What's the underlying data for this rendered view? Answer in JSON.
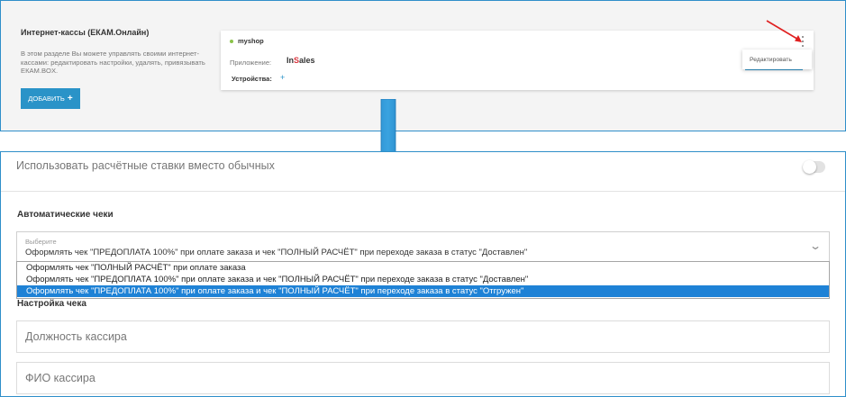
{
  "top": {
    "title": "Интернет-кассы (ЕКАМ.Онлайн)",
    "description": "В этом разделе Вы можете управлять своими интернет-кассами: редактировать настройки, удалять, привязывать ЕКАМ.BOX.",
    "add_button": "ДОБАВИТЬ",
    "add_icon": "plus-icon",
    "card": {
      "shop_name": "myshop",
      "status_color": "#8bc34a",
      "app_label": "Приложение:",
      "app_logo_prefix": "In",
      "app_logo_accent": "S",
      "app_logo_suffix": "ales",
      "devices_label": "Устройства:",
      "devices_add_icon": "plus-icon"
    },
    "menu": {
      "edit_label": "Редактировать"
    }
  },
  "bottom": {
    "toggle_label": "Использовать расчётные ставки вместо обычных",
    "toggle_on": false,
    "auto_receipts_heading": "Автоматические чеки",
    "select": {
      "label": "Выберите",
      "value": "Оформлять чек \"ПРЕДОПЛАТА 100%\" при оплате заказа и чек \"ПОЛНЫЙ РАСЧЁТ\" при переходе заказа в статус \"Доставлен\"",
      "icon": "chevron-down-icon",
      "options": [
        "Оформлять чек \"ПОЛНЫЙ РАСЧЁТ\" при оплате заказа",
        "Оформлять чек \"ПРЕДОПЛАТА 100%\" при оплате заказа и чек \"ПОЛНЫЙ РАСЧЁТ\" при переходе заказа в статус \"Доставлен\"",
        "Оформлять чек \"ПРЕДОПЛАТА 100%\" при оплате заказа и чек \"ПОЛНЫЙ РАСЧЁТ\" при переходе заказа в статус \"Отгружен\""
      ],
      "highlighted_index": 2
    },
    "receipt_settings_heading": "Настройка чека",
    "cashier_position_placeholder": "Должность кассира",
    "cashier_name_placeholder": "ФИО кассира"
  },
  "colors": {
    "accent": "#2a93c8",
    "frame": "#2f8fc9",
    "selection": "#1e82d6",
    "annotation_arrow": "#e02020"
  }
}
